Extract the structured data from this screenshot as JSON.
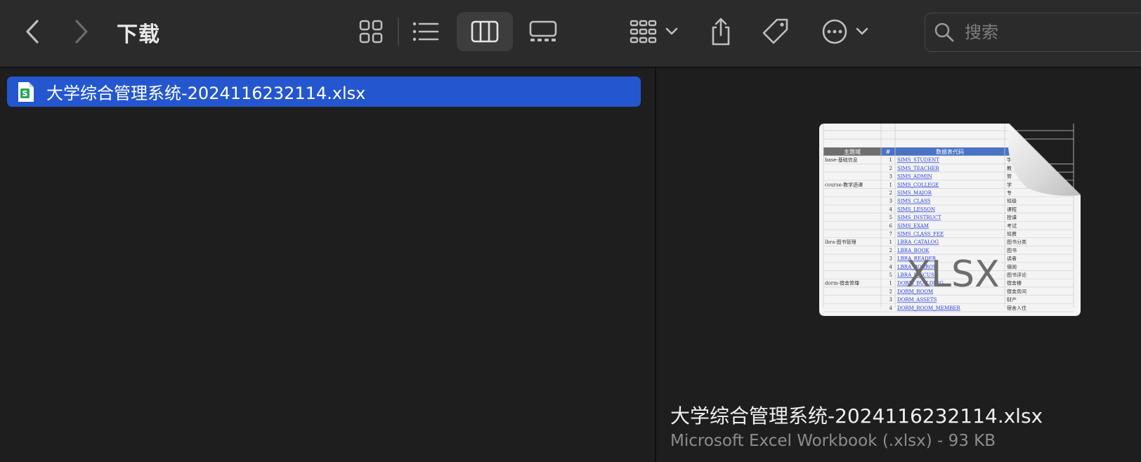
{
  "toolbar": {
    "title": "下载",
    "search_placeholder": "搜索",
    "active_view": "columns"
  },
  "column_view": {
    "items": [
      {
        "name": "大学综合管理系统-2024116232114.xlsx",
        "selected": true,
        "icon": "xlsx-file-icon"
      }
    ]
  },
  "preview": {
    "file_name": "大学综合管理系统-2024116232114.xlsx",
    "meta": "Microsoft Excel Workbook (.xlsx) - 93 KB",
    "thumb_badge": "XLSX",
    "sheet": {
      "headers": [
        "主题域",
        "#",
        "数据表代码"
      ],
      "rows": [
        {
          "domain": "base-基础信息",
          "num": "1",
          "code": "SIMS_STUDENT",
          "desc": "学"
        },
        {
          "domain": "",
          "num": "2",
          "code": "SIMS_TEACHER",
          "desc": "教"
        },
        {
          "domain": "",
          "num": "3",
          "code": "SIMS_ADMIN",
          "desc": "管"
        },
        {
          "domain": "course-教学选课",
          "num": "1",
          "code": "SIMS_COLLEGE",
          "desc": "学"
        },
        {
          "domain": "",
          "num": "2",
          "code": "SIMS_MAJOR",
          "desc": "专"
        },
        {
          "domain": "",
          "num": "3",
          "code": "SIMS_CLASS",
          "desc": "班级"
        },
        {
          "domain": "",
          "num": "4",
          "code": "SIMS_LESSON",
          "desc": "课程"
        },
        {
          "domain": "",
          "num": "5",
          "code": "SIMS_INSTRUCT",
          "desc": "授课"
        },
        {
          "domain": "",
          "num": "6",
          "code": "SIMS_EXAM",
          "desc": "考试"
        },
        {
          "domain": "",
          "num": "7",
          "code": "SIMS_CLASS_FEE",
          "desc": "班费"
        },
        {
          "domain": "lbra-图书管理",
          "num": "1",
          "code": "LBRA_CATALOG",
          "desc": "图书分类"
        },
        {
          "domain": "",
          "num": "2",
          "code": "LBRA_BOOK",
          "desc": "图书"
        },
        {
          "domain": "",
          "num": "3",
          "code": "LBRA_READER",
          "desc": "读者"
        },
        {
          "domain": "",
          "num": "4",
          "code": "LBRA_BORROW",
          "desc": "借阅"
        },
        {
          "domain": "",
          "num": "5",
          "code": "LBRA_DISCUSS",
          "desc": "图书评论"
        },
        {
          "domain": "dorm-宿舍管理",
          "num": "1",
          "code": "DORM_BUILDING",
          "desc": "宿舍楼"
        },
        {
          "domain": "",
          "num": "2",
          "code": "DORM_ROOM",
          "desc": "宿舍房间"
        },
        {
          "domain": "",
          "num": "3",
          "code": "DORM_ASSETS",
          "desc": "财产"
        },
        {
          "domain": "",
          "num": "4",
          "code": "DORM_ROOM_MEMBER",
          "desc": "宿舍入住"
        }
      ]
    }
  },
  "colors": {
    "selection": "#2457cf",
    "toolbar_bg": "#2b2b2b",
    "pane_bg": "#1e1e1e",
    "header_blue": "#4a73c4"
  }
}
